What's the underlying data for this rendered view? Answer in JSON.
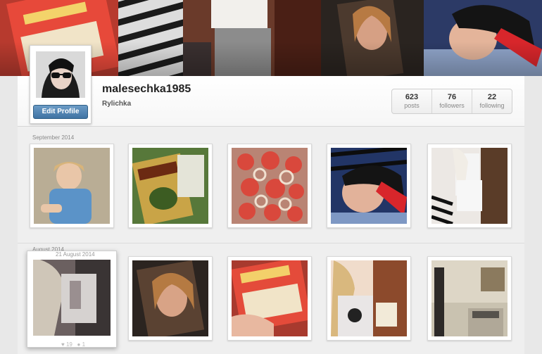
{
  "profile": {
    "username": "malesechka1985",
    "real_name": "Rylichka",
    "edit_label": "Edit Profile"
  },
  "stats": [
    {
      "value": "623",
      "label": "posts"
    },
    {
      "value": "76",
      "label": "followers"
    },
    {
      "value": "22",
      "label": "following"
    }
  ],
  "feed": {
    "sections": [
      {
        "month": "September 2014"
      },
      {
        "month": "August 2014"
      }
    ],
    "hover": {
      "date": "21 August 2014",
      "likes": "19",
      "comments": "1"
    }
  },
  "colors": {
    "accent": "#4f82b1",
    "page_bg": "#e8e8e8"
  }
}
